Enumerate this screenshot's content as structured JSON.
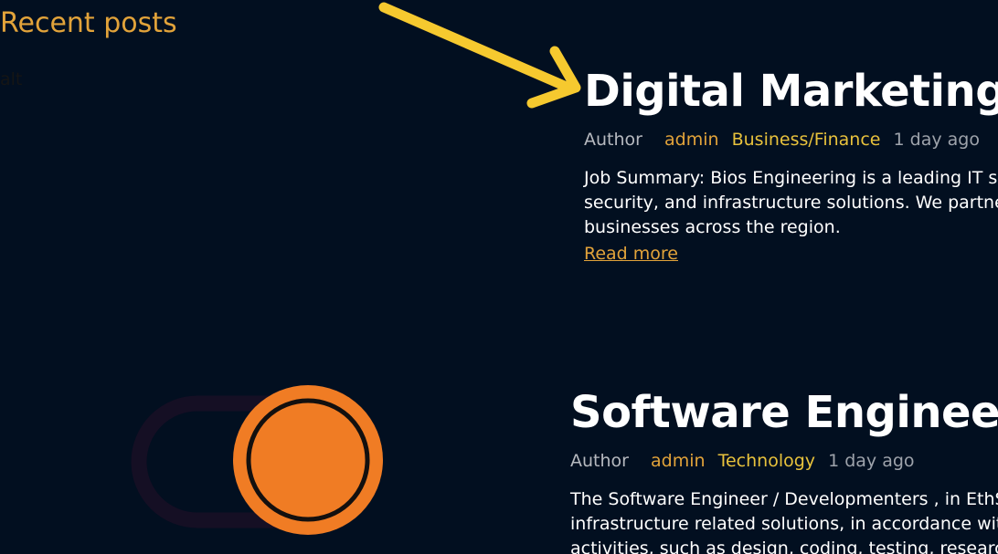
{
  "section": {
    "title": "Recent posts",
    "broken_image_alt": "alt"
  },
  "posts": [
    {
      "title": "Digital Marketing",
      "author_label": "Author",
      "author": "admin",
      "category": "Business/Finance",
      "date": "1 day ago",
      "excerpt_lines": [
        "Job Summary: Bios Engineering is a leading IT se",
        "security, and infrastructure solutions. We partne",
        "businesses across the region."
      ],
      "read_more": "Read more"
    },
    {
      "title": "Software Engineer",
      "author_label": "Author",
      "author": "admin",
      "category": "Technology",
      "date": "1 day ago",
      "excerpt_lines": [
        "The Software Engineer / Developmenters , in EthS",
        "infrastructure related solutions, in accordance wit",
        "activities, such as design, coding, testing, research"
      ]
    }
  ],
  "annotation": {
    "arrow_color": "#f6c92f",
    "icon": "arrow-icon"
  },
  "toggle": {
    "icon": "toggle-switch-icon",
    "knob_color": "#f07c24",
    "track_color": "#150f24"
  }
}
